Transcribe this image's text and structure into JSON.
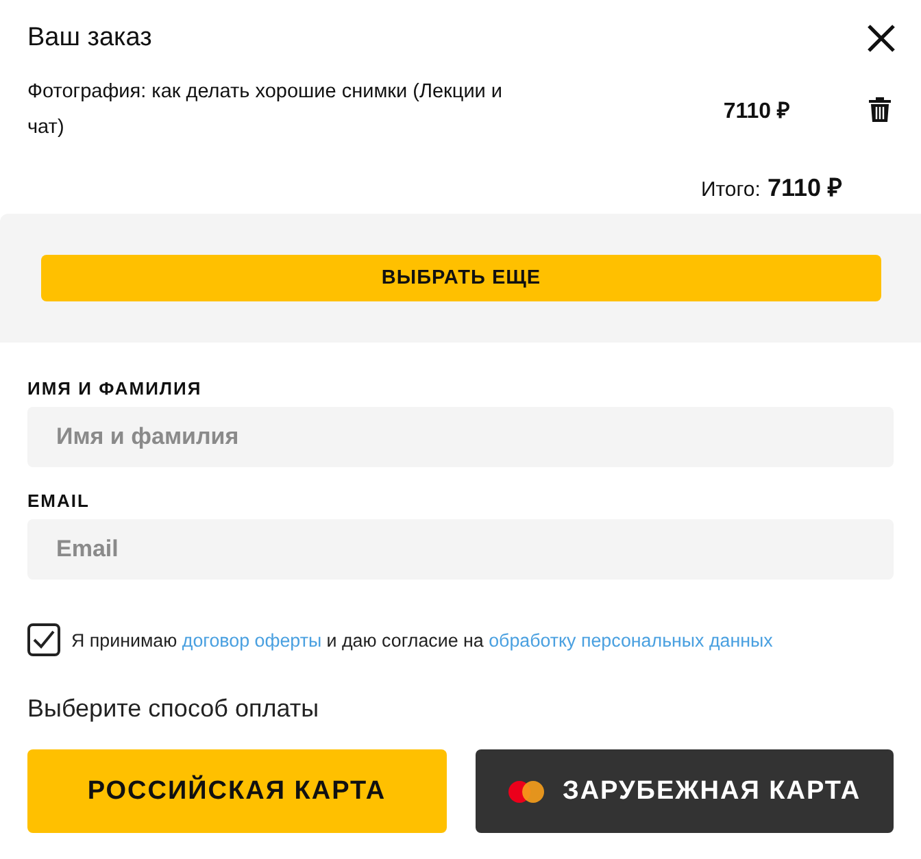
{
  "title": "Ваш заказ",
  "items": [
    {
      "name": "Фотография: как делать хорошие снимки (Лекции и чат)",
      "price": "7110 ₽"
    }
  ],
  "total": {
    "label": "Итого:",
    "value": "7110 ₽"
  },
  "more_button": "ВЫБРАТЬ ЕЩЕ",
  "fields": [
    {
      "label": "ИМЯ И ФАМИЛИЯ",
      "placeholder": "Имя и фамилия"
    },
    {
      "label": "EMAIL",
      "placeholder": "Email"
    }
  ],
  "consent": {
    "checked": true,
    "parts": [
      {
        "kind": "text",
        "text": "Я принимаю "
      },
      {
        "kind": "link",
        "text": "договор оферты"
      },
      {
        "kind": "text",
        "text": " и даю согласие на "
      },
      {
        "kind": "link",
        "text": "обработку персональных данных"
      }
    ]
  },
  "payment_prompt": "Выберите способ оплаты",
  "payment_buttons": [
    {
      "kind": "local",
      "label": "РОССИЙСКАЯ КАРТА"
    },
    {
      "kind": "foreign",
      "label": "ЗАРУБЕЖНАЯ КАРТА"
    }
  ]
}
